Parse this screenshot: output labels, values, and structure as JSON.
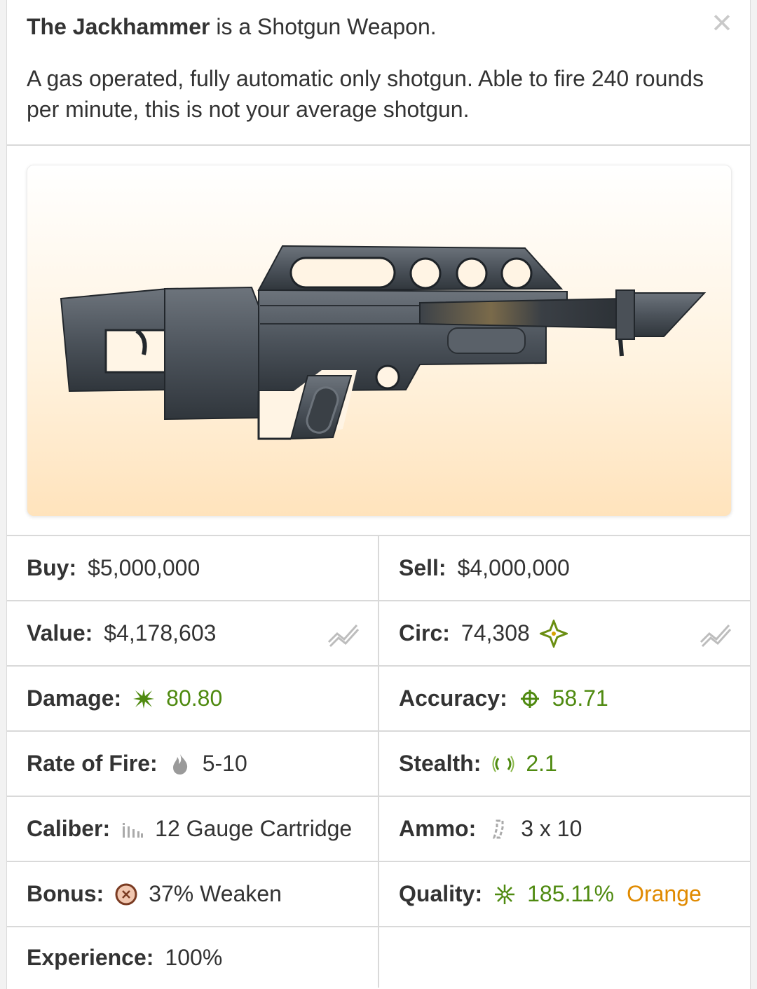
{
  "header": {
    "name": "The Jackhammer",
    "intro_rest": "is a Shotgun Weapon.",
    "description": "A gas operated, fully automatic only shotgun. Able to fire 240 rounds per minute, this is not your average shotgun.",
    "close_icon": "×"
  },
  "image": {
    "alt": "Jackhammer shotgun",
    "icon": "jackhammer-shotgun-image"
  },
  "stats": {
    "buy": {
      "label": "Buy:",
      "value": "$5,000,000"
    },
    "sell": {
      "label": "Sell:",
      "value": "$4,000,000"
    },
    "value": {
      "label": "Value:",
      "value": "$4,178,603",
      "icon": "trend-chart-icon"
    },
    "circ": {
      "label": "Circ:",
      "value": "74,308",
      "icon": "sparkle-icon",
      "trend_icon": "trend-chart-icon"
    },
    "damage": {
      "label": "Damage:",
      "value": "80.80",
      "icon": "damage-burst-icon"
    },
    "accuracy": {
      "label": "Accuracy:",
      "value": "58.71",
      "icon": "crosshair-icon"
    },
    "rate_of_fire": {
      "label": "Rate of Fire:",
      "value": "5-10",
      "icon": "flame-icon"
    },
    "stealth": {
      "label": "Stealth:",
      "value": "2.1",
      "icon": "signal-waves-icon"
    },
    "caliber": {
      "label": "Caliber:",
      "value": "12 Gauge Cartridge",
      "icon": "bullets-icon"
    },
    "ammo": {
      "label": "Ammo:",
      "value": "3 x 10",
      "icon": "magazine-icon"
    },
    "bonus": {
      "label": "Bonus:",
      "value": "37% Weaken",
      "icon": "weaken-bonus-icon"
    },
    "quality": {
      "label": "Quality:",
      "value": "185.11%",
      "rarity": "Orange",
      "icon": "quality-star-icon"
    },
    "experience": {
      "label": "Experience:",
      "value": "100%"
    }
  },
  "colors": {
    "positive": "#4f8a10",
    "rarity_orange": "#e08a00",
    "divider": "#d9d9d9"
  }
}
